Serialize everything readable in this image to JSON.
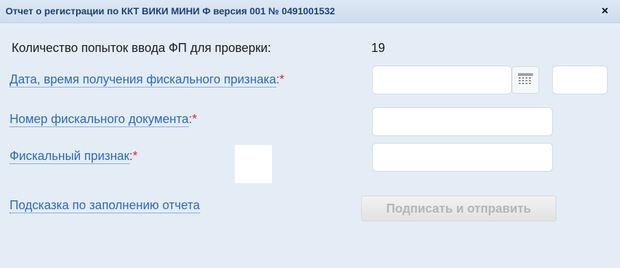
{
  "dialog": {
    "title": "Отчет о регистрации по ККТ ВИКИ МИНИ Ф версия 001 № 0491001532",
    "close_label": "×"
  },
  "form": {
    "attempts_label": "Количество попыток ввода ФП для проверки:",
    "attempts_value": "19",
    "datetime_label": "Дата, время получения фискального признака",
    "doc_number_label": "Номер фискального документа",
    "fiscal_sign_label": "Фискальный признак",
    "required_marker": ":*",
    "hint_link": "Подсказка по заполнению отчета",
    "submit_label": "Подписать и отправить",
    "datetime_date_value": "",
    "datetime_time_value": "",
    "doc_number_value": "",
    "fiscal_sign_value": ""
  },
  "icons": {
    "calendar": "calendar-icon",
    "close": "close-icon"
  }
}
